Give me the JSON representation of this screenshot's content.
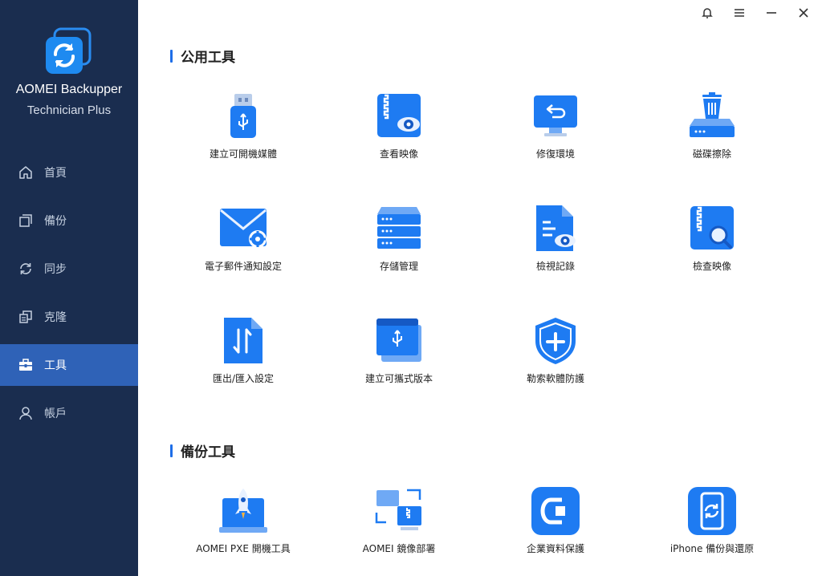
{
  "app": {
    "name_line1": "AOMEI Backupper",
    "name_line2": "Technician Plus"
  },
  "nav": [
    {
      "label": "首頁",
      "icon": "home-icon"
    },
    {
      "label": "備份",
      "icon": "backup-icon"
    },
    {
      "label": "同步",
      "icon": "sync-icon"
    },
    {
      "label": "克隆",
      "icon": "clone-icon"
    },
    {
      "label": "工具",
      "icon": "toolbox-icon",
      "active": true
    },
    {
      "label": "帳戶",
      "icon": "user-icon"
    }
  ],
  "window_controls": [
    "bell-icon",
    "menu-icon",
    "minimize-icon",
    "close-icon"
  ],
  "sections": {
    "common": {
      "title": "公用工具",
      "tools": [
        {
          "label": "建立可開機媒體",
          "icon": "usb-drive-icon"
        },
        {
          "label": "查看映像",
          "icon": "image-view-icon"
        },
        {
          "label": "修復環境",
          "icon": "recovery-env-icon"
        },
        {
          "label": "磁碟擦除",
          "icon": "disk-wipe-icon"
        },
        {
          "label": "電子郵件通知設定",
          "icon": "email-settings-icon"
        },
        {
          "label": "存儲管理",
          "icon": "storage-icon"
        },
        {
          "label": "檢視記錄",
          "icon": "log-view-icon"
        },
        {
          "label": "檢查映像",
          "icon": "image-check-icon"
        },
        {
          "label": "匯出/匯入設定",
          "icon": "import-export-icon"
        },
        {
          "label": "建立可攜式版本",
          "icon": "portable-version-icon"
        },
        {
          "label": "勒索軟體防護",
          "icon": "shield-plus-icon"
        }
      ]
    },
    "backup": {
      "title": "備份工具",
      "tools": [
        {
          "label": "AOMEI PXE 開機工具",
          "icon": "pxe-rocket-icon"
        },
        {
          "label": "AOMEI 鏡像部署",
          "icon": "image-deploy-icon"
        },
        {
          "label": "企業資料保護",
          "icon": "enterprise-protect-icon"
        },
        {
          "label": "iPhone 備份與還原",
          "icon": "iphone-backup-icon"
        }
      ]
    }
  },
  "colors": {
    "sidebar": "#1a2d4f",
    "active": "#2f62b7",
    "accent": "#1e6ee8"
  }
}
